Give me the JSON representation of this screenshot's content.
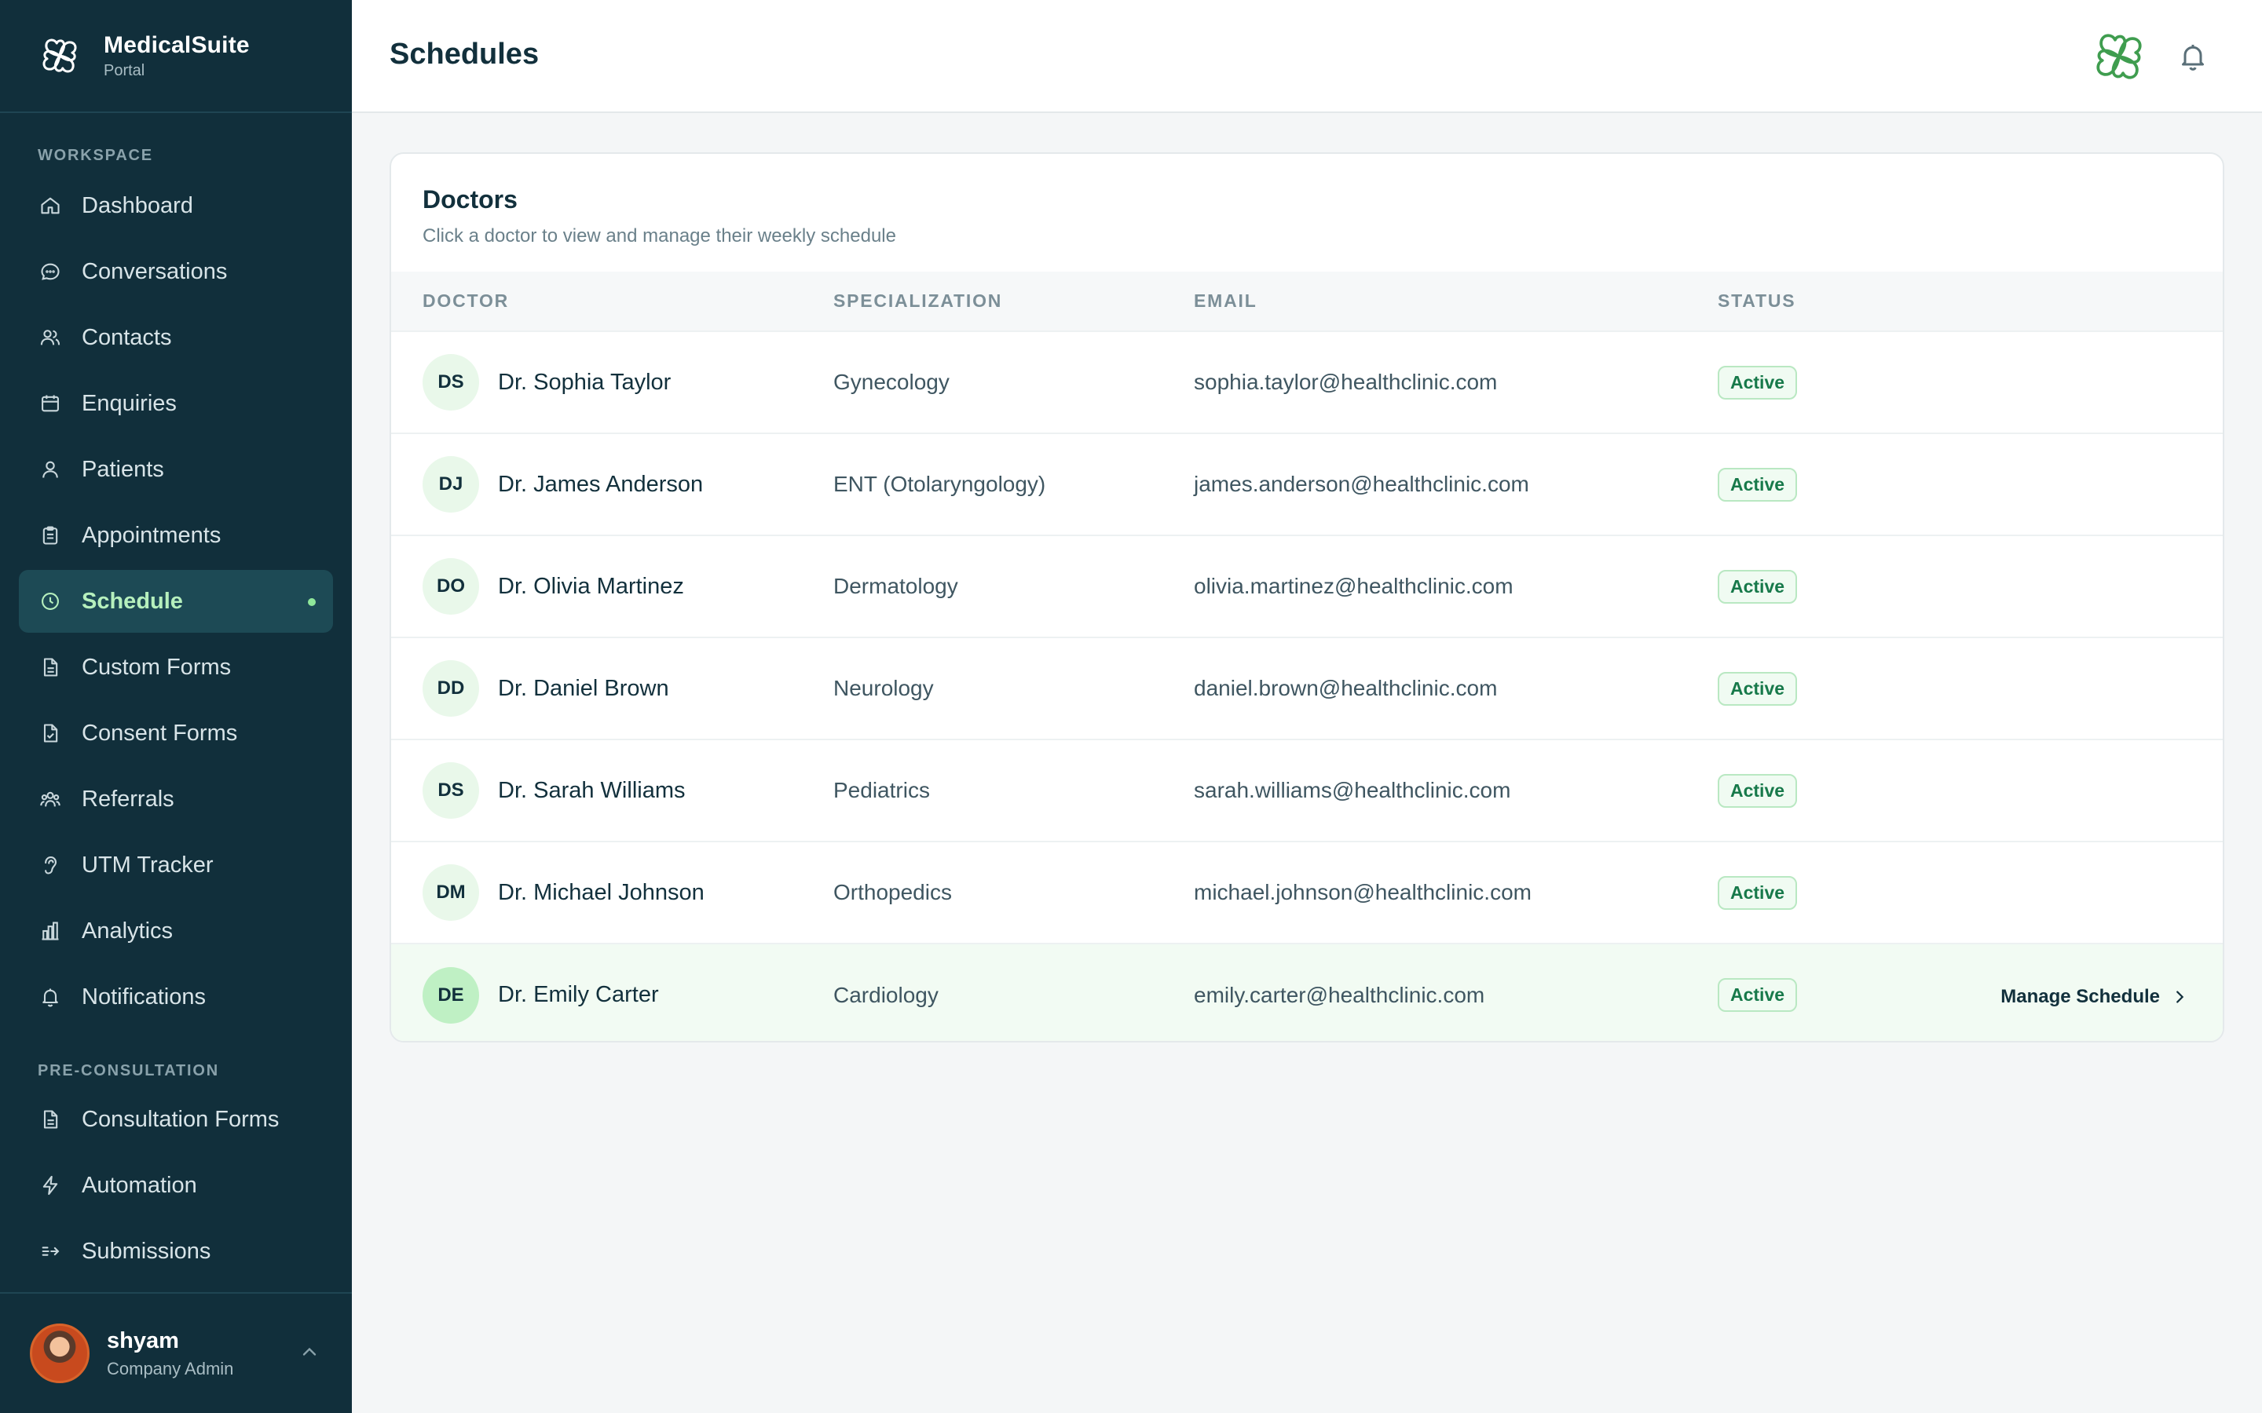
{
  "brand": {
    "name": "MedicalSuite",
    "subtitle": "Portal"
  },
  "sidebar": {
    "sections": [
      {
        "label": "WORKSPACE",
        "items": [
          {
            "label": "Dashboard",
            "icon": "home-icon"
          },
          {
            "label": "Conversations",
            "icon": "chat-bubble-icon"
          },
          {
            "label": "Contacts",
            "icon": "users-icon"
          },
          {
            "label": "Enquiries",
            "icon": "calendar-icon"
          },
          {
            "label": "Patients",
            "icon": "user-icon"
          },
          {
            "label": "Appointments",
            "icon": "clipboard-icon"
          },
          {
            "label": "Schedule",
            "icon": "clock-icon",
            "active": true
          },
          {
            "label": "Custom Forms",
            "icon": "document-icon"
          },
          {
            "label": "Consent Forms",
            "icon": "document-check-icon"
          },
          {
            "label": "Referrals",
            "icon": "user-group-icon"
          },
          {
            "label": "UTM Tracker",
            "icon": "ear-icon"
          },
          {
            "label": "Analytics",
            "icon": "bar-chart-icon"
          },
          {
            "label": "Notifications",
            "icon": "bell-icon"
          }
        ]
      },
      {
        "label": "PRE-CONSULTATION",
        "items": [
          {
            "label": "Consultation Forms",
            "icon": "document-icon"
          },
          {
            "label": "Automation",
            "icon": "lightning-icon"
          },
          {
            "label": "Submissions",
            "icon": "arrow-list-icon"
          }
        ]
      }
    ]
  },
  "user": {
    "name": "shyam",
    "role": "Company Admin"
  },
  "header": {
    "title": "Schedules"
  },
  "card": {
    "title": "Doctors",
    "subtitle": "Click a doctor to view and manage their weekly schedule",
    "columns": [
      "DOCTOR",
      "SPECIALIZATION",
      "EMAIL",
      "STATUS"
    ],
    "action_label": "Manage Schedule",
    "rows": [
      {
        "initials": "DS",
        "name": "Dr. Sophia Taylor",
        "specialization": "Gynecology",
        "email": "sophia.taylor@healthclinic.com",
        "status": "Active"
      },
      {
        "initials": "DJ",
        "name": "Dr. James Anderson",
        "specialization": "ENT (Otolaryngology)",
        "email": "james.anderson@healthclinic.com",
        "status": "Active"
      },
      {
        "initials": "DO",
        "name": "Dr. Olivia Martinez",
        "specialization": "Dermatology",
        "email": "olivia.martinez@healthclinic.com",
        "status": "Active"
      },
      {
        "initials": "DD",
        "name": "Dr. Daniel Brown",
        "specialization": "Neurology",
        "email": "daniel.brown@healthclinic.com",
        "status": "Active"
      },
      {
        "initials": "DS",
        "name": "Dr. Sarah Williams",
        "specialization": "Pediatrics",
        "email": "sarah.williams@healthclinic.com",
        "status": "Active"
      },
      {
        "initials": "DM",
        "name": "Dr. Michael Johnson",
        "specialization": "Orthopedics",
        "email": "michael.johnson@healthclinic.com",
        "status": "Active"
      },
      {
        "initials": "DE",
        "name": "Dr. Emily Carter",
        "specialization": "Cardiology",
        "email": "emily.carter@healthclinic.com",
        "status": "Active",
        "hovered": true
      }
    ]
  },
  "colors": {
    "sidebar_bg": "#112f3b",
    "accent_green": "#3f9d4f",
    "active_text": "#b6f0bd",
    "badge_text": "#17794a"
  }
}
